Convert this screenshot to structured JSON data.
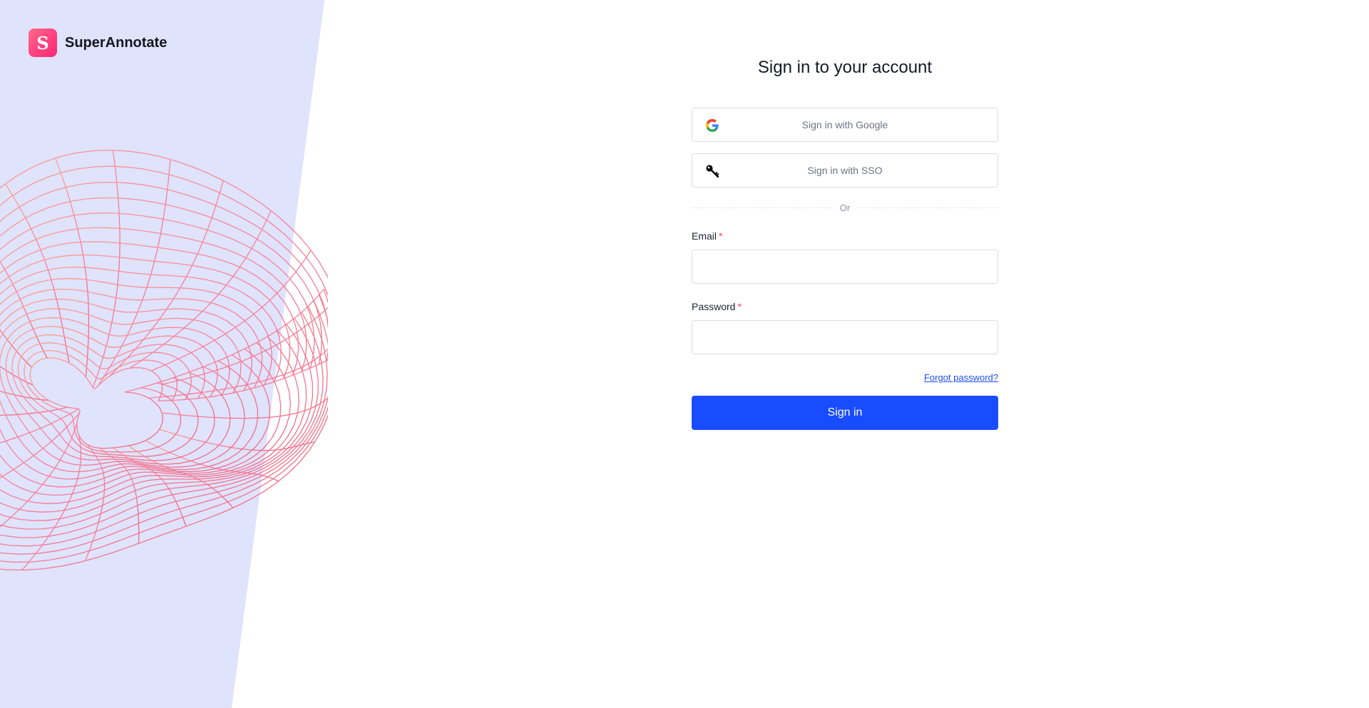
{
  "brand": {
    "logo_letter": "S",
    "name": "SuperAnnotate"
  },
  "signin": {
    "title": "Sign in to your account",
    "google_label": "Sign in with Google",
    "sso_label": "Sign in with SSO",
    "divider_text": "Or",
    "email_label": "Email",
    "password_label": "Password",
    "required_marker": "*",
    "email_value": "",
    "password_value": "",
    "forgot_label": "Forgot password?",
    "submit_label": "Sign in"
  },
  "icons": {
    "google": "google-g-icon",
    "sso": "key-icon"
  },
  "colors": {
    "left_panel_bg": "#dfe3fc",
    "wave_lines": "#f47d97",
    "primary": "#1a4cff",
    "link": "#1f4fff",
    "required": "#ff3b4e",
    "logo_gradient_start": "#ff6a88",
    "logo_gradient_end": "#f72a6e"
  }
}
